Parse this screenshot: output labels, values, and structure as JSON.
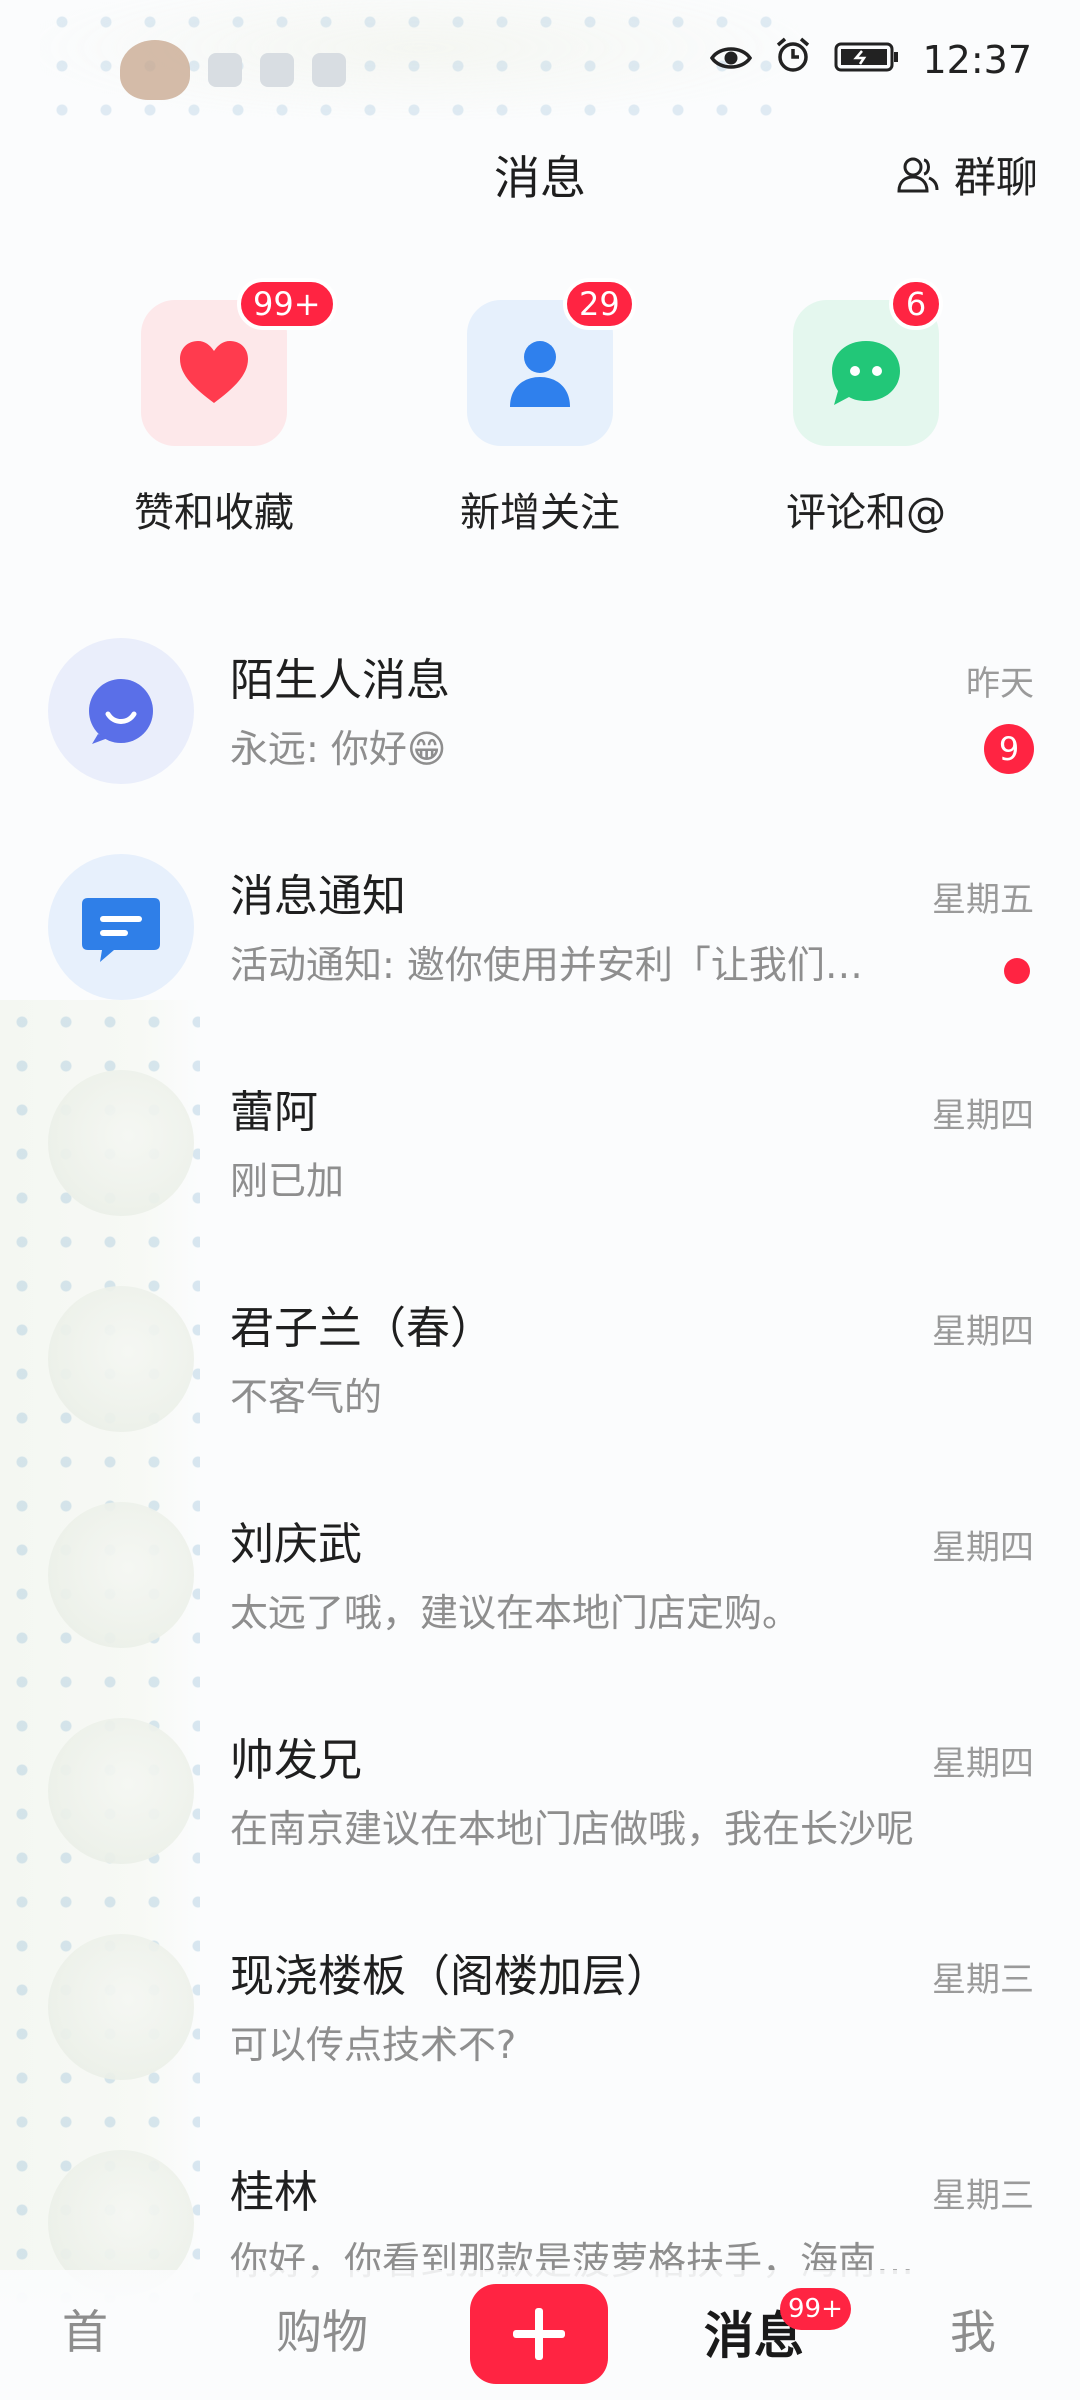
{
  "status_bar": {
    "time": "12:37",
    "icons": [
      "eye-icon",
      "alarm-icon",
      "battery-icon"
    ]
  },
  "header": {
    "title": "消息",
    "group_chat_label": "群聊",
    "group_chat_icon": "people-icon"
  },
  "quick_actions": [
    {
      "label": "赞和收藏",
      "badge": "99+",
      "icon": "heart-icon",
      "bg": "#fde8ea",
      "color": "#ff3b4e"
    },
    {
      "label": "新增关注",
      "badge": "29",
      "icon": "person-icon",
      "bg": "#e6f0fc",
      "color": "#2f80ed"
    },
    {
      "label": "评论和@",
      "badge": "6",
      "icon": "chat-bubble-icon",
      "bg": "#e4f7ee",
      "color": "#22c778"
    }
  ],
  "conversations": [
    {
      "name": "陌生人消息",
      "time": "昨天",
      "preview": "永远: 你好😁",
      "unread": "9",
      "avatar": "stranger-chat-icon"
    },
    {
      "name": "消息通知",
      "time": "星期五",
      "preview": "活动通知: 邀你使用并安利「让我们…",
      "unread_dot": true,
      "avatar": "notification-icon"
    },
    {
      "name": "蕾阿",
      "time": "星期四",
      "preview": "刚已加"
    },
    {
      "name": "君子兰（春）",
      "time": "星期四",
      "preview": "不客气的"
    },
    {
      "name": "刘庆武",
      "time": "星期四",
      "preview": "太远了哦，建议在本地门店定购。"
    },
    {
      "name": "帅发兄",
      "time": "星期四",
      "preview": "在南京建议在本地门店做哦，我在长沙呢"
    },
    {
      "name": "现浇楼板（阁楼加层）",
      "time": "星期三",
      "preview": "可以传点技术不?"
    },
    {
      "name": "桂林",
      "time": "星期三",
      "preview": "你好，你看到那款是菠萝格扶手，海南的…"
    }
  ],
  "tab_bar": {
    "home": "首",
    "shop": "购物",
    "messages": "消息",
    "messages_badge": "99+",
    "me": "我",
    "accent": "#ff2442"
  }
}
